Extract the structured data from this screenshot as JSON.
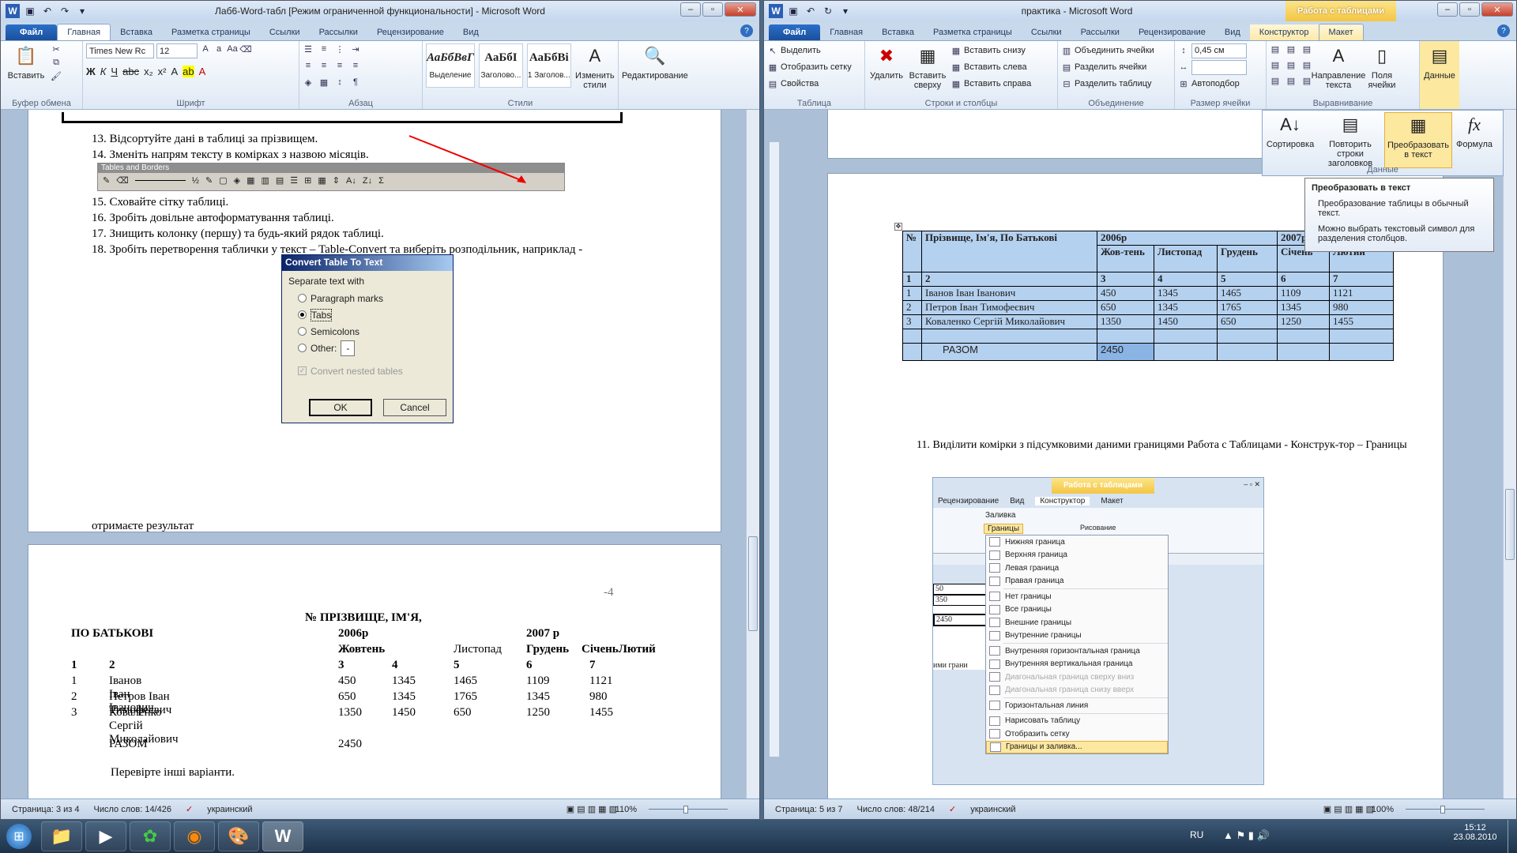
{
  "left": {
    "title": "Лаб6-Word-табл [Режим ограниченной функциональности]  -  Microsoft Word",
    "tabs": [
      "Файл",
      "Главная",
      "Вставка",
      "Разметка страницы",
      "Ссылки",
      "Рассылки",
      "Рецензирование",
      "Вид"
    ],
    "ribbon": {
      "paste": "Вставить",
      "font_name": "Times New Rc",
      "font_size": "12",
      "styles": [
        {
          "sample": "АаБбВвГ",
          "name": "Выделение"
        },
        {
          "sample": "АаБбІ",
          "name": "Заголово..."
        },
        {
          "sample": "АаБбВі",
          "name": "1 Заголов..."
        }
      ],
      "change_styles": "Изменить стили",
      "editing": "Редактирование",
      "groups": [
        "Буфер обмена",
        "Шрифт",
        "Абзац",
        "Стили"
      ]
    },
    "doc": {
      "items": [
        "13. Відсортуйте дані в таблиці за прізвищем.",
        "14. Зменіть напрям тексту в комірках з назвою місяців.",
        "15. Сховайте сітку таблиці.",
        "16. Зробіть довільне автоформатування таблиці.",
        "17. Знищить колонку (першу) та будь-який рядок таблиці.",
        "18. Зробіть перетворення таблички  у текст – Table-Convert та виберіть розподільник, наприклад -"
      ],
      "toolbar_title": "Tables and Borders",
      "dialog": {
        "title": "Convert Table To Text",
        "group": "Separate text with",
        "options": [
          "Paragraph marks",
          "Tabs",
          "Semicolons",
          "Other:"
        ],
        "other_value": "-",
        "nested": "Convert nested tables",
        "ok": "OK",
        "cancel": "Cancel"
      },
      "result": "отримаєте результат",
      "page_num": "-4",
      "text_table": {
        "h1": "№        ПРІЗВИЩЕ, ІМ'Я,",
        "h2a": "ПО БАТЬКОВІ",
        "h2b": "2006р",
        "h2c": "2007 р",
        "h3a": "Жовтень",
        "h3b": "Листопад",
        "h3c": "Грудень",
        "h3d": "СіченьЛютий",
        "nums": [
          "1",
          "2",
          "3",
          "4",
          "5",
          "6",
          "7"
        ],
        "rows": [
          [
            "1",
            "Іванов Іван Іванович",
            "450",
            "1345",
            "1465",
            "1109",
            "1121"
          ],
          [
            "2",
            "Петров Іван Тимофеєвич",
            "650",
            "1345",
            "1765",
            "1345",
            "980"
          ],
          [
            "3",
            "Коваленко Сергій Миколайович",
            "1350",
            "1450",
            "650",
            "1250",
            "1455"
          ]
        ],
        "total_label": "РАЗОМ",
        "total_value": "2450"
      },
      "footer": "Перевірте інші варіанти."
    },
    "status": {
      "page": "Страница: 3 из 4",
      "words": "Число слов: 14/426",
      "lang": "украинский",
      "zoom": "110%"
    }
  },
  "right": {
    "title": "практика  -  Microsoft Word",
    "context_band": "Работа с таблицами",
    "tabs": [
      "Файл",
      "Главная",
      "Вставка",
      "Разметка страницы",
      "Ссылки",
      "Рассылки",
      "Рецензирование",
      "Вид",
      "Конструктор",
      "Макет"
    ],
    "ribbon": {
      "select": "Выделить",
      "gridlines": "Отобразить сетку",
      "properties": "Свойства",
      "delete": "Удалить",
      "insert_above": "Вставить сверху",
      "insert_below": "Вставить снизу",
      "insert_left": "Вставить слева",
      "insert_right": "Вставить справа",
      "merge": "Объединить ячейки",
      "split": "Разделить ячейки",
      "split_table": "Разделить таблицу",
      "width_value": "0,45 см",
      "autofit": "Автоподбор",
      "direction": "Направление текста",
      "margins": "Поля ячейки",
      "data": "Данные",
      "groups": [
        "Таблица",
        "Строки и столбцы",
        "Объединение",
        "Размер ячейки",
        "Выравнивание"
      ]
    },
    "data_menu": {
      "sort": "Сортировка",
      "repeat": "Повторить строки заголовков",
      "convert": "Преобразовать в текст",
      "formula": "Формула",
      "label": "Данные"
    },
    "tooltip": {
      "title": "Преобразовать в текст",
      "line1": "Преобразование таблицы в обычный текст.",
      "line2": "Можно выбрать текстовый символ для разделения столбцов."
    },
    "table": {
      "h_no": "№",
      "h_name": "Прізвище, Ім'я, По Батькові",
      "h_2006": "2006р",
      "h_2007": "2007р",
      "months": [
        "Жов-тень",
        "Листопад",
        "Грудень",
        "Січень",
        "Лютий"
      ],
      "nums": [
        "1",
        "2",
        "3",
        "4",
        "5",
        "6",
        "7"
      ],
      "rows": [
        [
          "1",
          "Іванов Іван Іванович",
          "450",
          "1345",
          "1465",
          "1109",
          "1121"
        ],
        [
          "2",
          "Петров Іван Тимофеєвич",
          "650",
          "1345",
          "1765",
          "1345",
          "980"
        ],
        [
          "3",
          "Коваленко Сергій Миколайович",
          "1350",
          "1450",
          "650",
          "1250",
          "1455"
        ]
      ],
      "total_label": "РАЗОМ",
      "total_value": "2450"
    },
    "step11": "11. Виділити комірки з підсумковими даними границями Работа с Таблицами - Конструк-тор – Границы",
    "shot": {
      "band": "Работа с таблицами",
      "tabs": [
        "Рецензирование",
        "Вид",
        "Конструктор",
        "Макет"
      ],
      "fill": "Заливка",
      "borders": "Границы",
      "draw": "Рисование",
      "menu": [
        "Нижняя граница",
        "Верхняя граница",
        "Левая граница",
        "Правая граница",
        "Нет границы",
        "Все границы",
        "Внешние границы",
        "Внутренние границы",
        "Внутренняя горизонтальная граница",
        "Внутренняя вертикальная граница",
        "Диагональная граница сверху вниз",
        "Диагональная граница снизу вверх",
        "Горизонтальная линия",
        "Нарисовать таблицу",
        "Отобразить сетку",
        "Границы и заливка..."
      ],
      "cells": [
        "50",
        "350",
        "2450"
      ],
      "partial": "ими грани"
    },
    "status": {
      "page": "Страница: 5 из 7",
      "words": "Число слов: 48/214",
      "lang": "украинский",
      "zoom": "100%"
    }
  },
  "taskbar": {
    "lang": "RU",
    "time": "15:12",
    "date": "23.08.2010"
  }
}
